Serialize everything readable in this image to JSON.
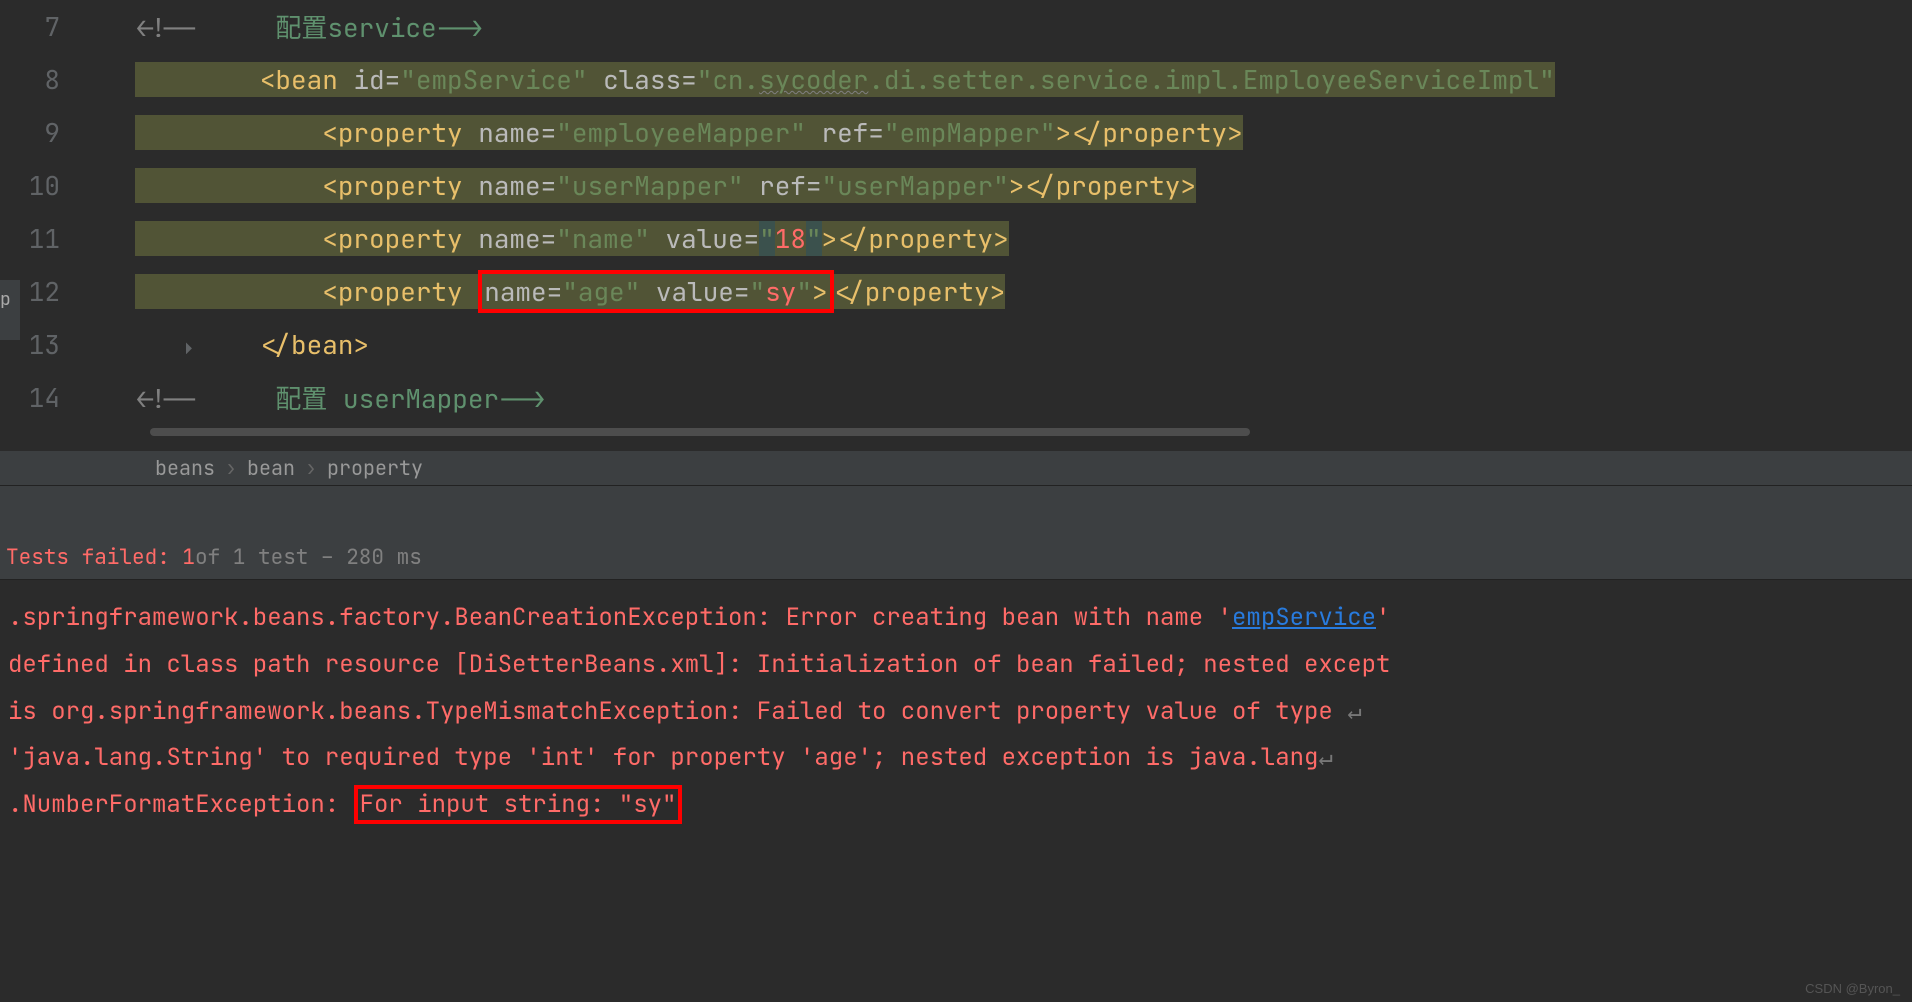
{
  "editor": {
    "lines": {
      "l7": {
        "num": "7",
        "comment_open": "<!--     ",
        "comment_cn": "配置",
        "comment_rest": "service-->"
      },
      "l8": {
        "num": "8",
        "indent": "        ",
        "tag_open": "<bean",
        "attr1": " id",
        "eq1": "=",
        "val1q": "\"",
        "val1": "empService",
        "val1q2": "\"",
        "attr2": " class",
        "eq2": "=",
        "val2q": "\"",
        "val2": "cn.",
        "val2b": "sycoder",
        "val2c": ".di.setter.service.impl.EmployeeServiceImpl",
        "val2q2": "\""
      },
      "l9": {
        "num": "9",
        "indent": "            ",
        "tag": "property",
        "attr1": "name",
        "val1": "employeeMapper",
        "attr2": "ref",
        "val2": "empMapper"
      },
      "l10": {
        "num": "10",
        "indent": "            ",
        "tag": "property",
        "attr1": "name",
        "val1": "userMapper",
        "attr2": "ref",
        "val2": "userMapper"
      },
      "l11": {
        "num": "11",
        "indent": "            ",
        "tag": "property",
        "attr1": "name",
        "val1": "name",
        "attr2": "value",
        "val2": "18"
      },
      "l12": {
        "num": "12",
        "indent": "            ",
        "tag": "property",
        "attr1": "name",
        "val1": "age",
        "attr2": "value",
        "val2": "sy"
      },
      "l13": {
        "num": "13",
        "indent": "        ",
        "tag": "bean"
      },
      "l14": {
        "num": "14",
        "comment_open": "<!--     ",
        "comment_cn": "配置",
        "comment_rest": " userMapper-->"
      }
    }
  },
  "breadcrumb": {
    "items": [
      "beans",
      "bean",
      "property"
    ]
  },
  "test_status": {
    "failed_label": "Tests failed: 1",
    "info": " of 1 test – 280 ms"
  },
  "console": {
    "line1a": ".springframework.beans.factory.BeanCreationException: ",
    "line1b": "Error creating bean with name '",
    "line1_link": "empService",
    "line2": "defined in class path resource [DiSetterBeans.xml]: Initialization of bean failed; nested except",
    "line3": "is org.springframework.beans.TypeMismatchException: Failed to convert property value of type ",
    "line4": "'java.lang.String' to required type 'int' for property 'age'; nested exception is java.lang",
    "line5a": ".NumberFormatException: ",
    "line5_boxed": "For input string: \"sy\""
  },
  "watermark": "CSDN @Byron_",
  "left_label": "p"
}
